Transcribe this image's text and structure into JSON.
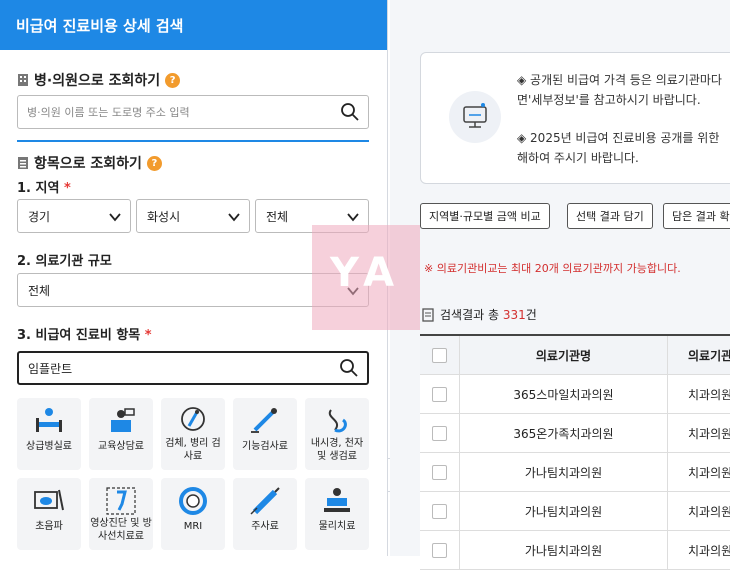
{
  "header": {
    "title": "비급여 진료비용 상세 검색"
  },
  "hospital_search": {
    "title": "병·의원으로 조회하기",
    "help": "?",
    "placeholder": "병·의원 이름 또는 도로명 주소 입력"
  },
  "item_search": {
    "title": "항목으로 조회하기",
    "help": "?",
    "region_label": "1. 지역",
    "required_mark": "*",
    "region_selects": [
      "경기",
      "화성시",
      "전체"
    ],
    "scale_label": "2. 의료기관 규모",
    "scale_value": "전체",
    "item_label": "3. 비급여 진료비 항목",
    "item_query": "임플란트"
  },
  "categories": [
    {
      "icon": "hospital-bed-icon",
      "label": "상급병실료"
    },
    {
      "icon": "counseling-icon",
      "label": "교육상담료"
    },
    {
      "icon": "microscope-icon",
      "label": "검체, 병리 검사료"
    },
    {
      "icon": "function-test-icon",
      "label": "기능검사료"
    },
    {
      "icon": "endoscope-icon",
      "label": "내시경, 천자 및 생검료"
    },
    {
      "icon": "ultrasound-icon",
      "label": "초음파"
    },
    {
      "icon": "xray-icon",
      "label": "영상진단 및 방사선치료료"
    },
    {
      "icon": "mri-icon",
      "label": "MRI"
    },
    {
      "icon": "syringe-icon",
      "label": "주사료"
    },
    {
      "icon": "physical-therapy-icon",
      "label": "물리치료"
    }
  ],
  "notice": {
    "lines": [
      "◈ 공개된 비급여 가격 등은 의료기관마다",
      "면'세부정보'를 참고하시기 바랍니다.",
      "◈ 2025년 비급여 진료비용 공개를 위한",
      "해하여 주시기 바랍니다."
    ]
  },
  "buttons": [
    "지역별·규모별 금액 비교",
    "선택 결과 담기",
    "담은 결과 확"
  ],
  "warning": "※ 의료기관비교는 최대 20개 의료기관까지 가능합니다.",
  "results": {
    "prefix": "검색결과 총 ",
    "count": "331",
    "suffix": "건"
  },
  "table": {
    "headers": [
      "의료기관명",
      "의료기관구"
    ],
    "rows": [
      {
        "name": "365스마일치과의원",
        "type": "치과의원"
      },
      {
        "name": "365온가족치과의원",
        "type": "치과의원"
      },
      {
        "name": "가나팀치과의원",
        "type": "치과의원"
      },
      {
        "name": "가나팀치과의원",
        "type": "치과의원"
      },
      {
        "name": "가나팀치과의원",
        "type": "치과의원"
      }
    ]
  },
  "watermark": "YA",
  "colors": {
    "brand": "#1e88e5",
    "warning": "#d32f2f",
    "help": "#f29b2d"
  }
}
